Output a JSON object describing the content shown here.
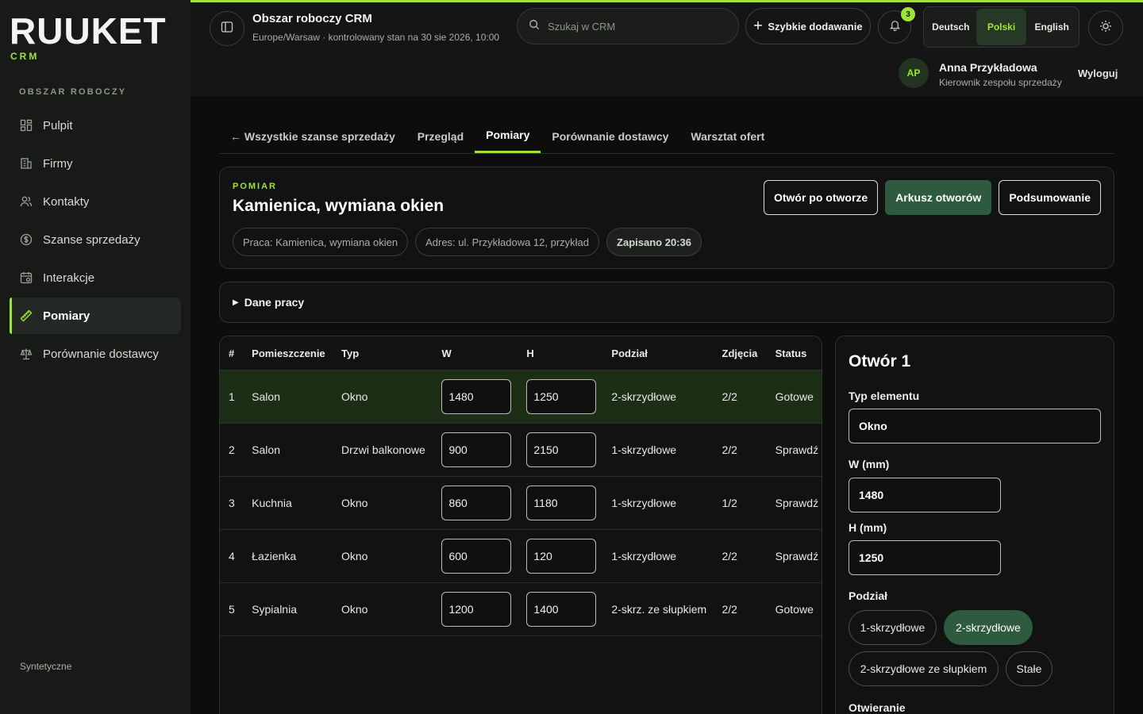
{
  "brand": {
    "name": "RUUKET",
    "sub": "CRM"
  },
  "sidebar": {
    "section": "OBSZAR ROBOCZY",
    "items": [
      {
        "label": "Pulpit",
        "icon": "dashboard-icon"
      },
      {
        "label": "Firmy",
        "icon": "building-icon"
      },
      {
        "label": "Kontakty",
        "icon": "users-icon"
      },
      {
        "label": "Szanse sprzedaży",
        "icon": "dollar-icon"
      },
      {
        "label": "Interakcje",
        "icon": "calendar-icon"
      },
      {
        "label": "Pomiary",
        "icon": "ruler-icon",
        "active": true
      },
      {
        "label": "Porównanie dostawcy",
        "icon": "scale-icon"
      }
    ],
    "footer": "Syntetyczne"
  },
  "header": {
    "title": "Obszar roboczy CRM",
    "subtitle": "Europe/Warsaw · kontrolowany stan na 30 sie 2026, 10:00",
    "search_placeholder": "Szukaj w CRM",
    "quick_add": "Szybkie dodawanie",
    "notifications": "3",
    "languages": [
      "Deutsch",
      "Polski",
      "English"
    ],
    "active_language": "Polski",
    "user": {
      "initials": "AP",
      "name": "Anna Przykładowa",
      "role": "Kierownik zespołu sprzedaży"
    },
    "logout": "Wyloguj"
  },
  "tabs": [
    {
      "label": "← Wszystkie szanse sprzedaży"
    },
    {
      "label": "Przegląd"
    },
    {
      "label": "Pomiary",
      "active": true
    },
    {
      "label": "Porównanie dostawcy"
    },
    {
      "label": "Warsztat ofert"
    }
  ],
  "measurement": {
    "eyebrow": "POMIAR",
    "title": "Kamienica, wymiana okien",
    "chips": [
      "Praca: Kamienica, wymiana okien",
      "Adres: ul. Przykładowa 12, przykład",
      "Zapisano 20:36"
    ],
    "actions": [
      "Otwór po otworze",
      "Arkusz otworów",
      "Podsumowanie"
    ]
  },
  "accordion": {
    "label": "Dane pracy"
  },
  "table": {
    "headers": [
      "#",
      "Pomieszczenie",
      "Typ",
      "W",
      "H",
      "Podział",
      "Zdjęcia",
      "Status"
    ],
    "rows": [
      {
        "num": "1",
        "room": "Salon",
        "type": "Okno",
        "w": "1480",
        "h": "1250",
        "div": "2-skrzydłowe",
        "photos": "2/2",
        "status": "Gotowe"
      },
      {
        "num": "2",
        "room": "Salon",
        "type": "Drzwi balkonowe",
        "w": "900",
        "h": "2150",
        "div": "1-skrzydłowe",
        "photos": "2/2",
        "status": "Sprawdź"
      },
      {
        "num": "3",
        "room": "Kuchnia",
        "type": "Okno",
        "w": "860",
        "h": "1180",
        "div": "1-skrzydłowe",
        "photos": "1/2",
        "status": "Sprawdź"
      },
      {
        "num": "4",
        "room": "Łazienka",
        "type": "Okno",
        "w": "600",
        "h": "120",
        "div": "1-skrzydłowe",
        "photos": "2/2",
        "status": "Sprawdź"
      },
      {
        "num": "5",
        "room": "Sypialnia",
        "type": "Okno",
        "w": "1200",
        "h": "1400",
        "div": "2-skrz. ze słupkiem",
        "photos": "2/2",
        "status": "Gotowe"
      }
    ]
  },
  "detail": {
    "title": "Otwór 1",
    "type_label": "Typ elementu",
    "type_value": "Okno",
    "w_label": "W (mm)",
    "w_value": "1480",
    "h_label": "H (mm)",
    "h_value": "1250",
    "division_label": "Podział",
    "division_options": [
      "1-skrzydłowe",
      "2-skrzydłowe",
      "2-skrzydłowe ze słupkiem",
      "Stałe"
    ],
    "division_selected": "2-skrzydłowe",
    "opening_label": "Otwieranie"
  },
  "colors": {
    "accent": "#9ee53a",
    "primary": "#2e5a3f",
    "bg": "#0c0d0c",
    "sidebar": "#181a18"
  }
}
